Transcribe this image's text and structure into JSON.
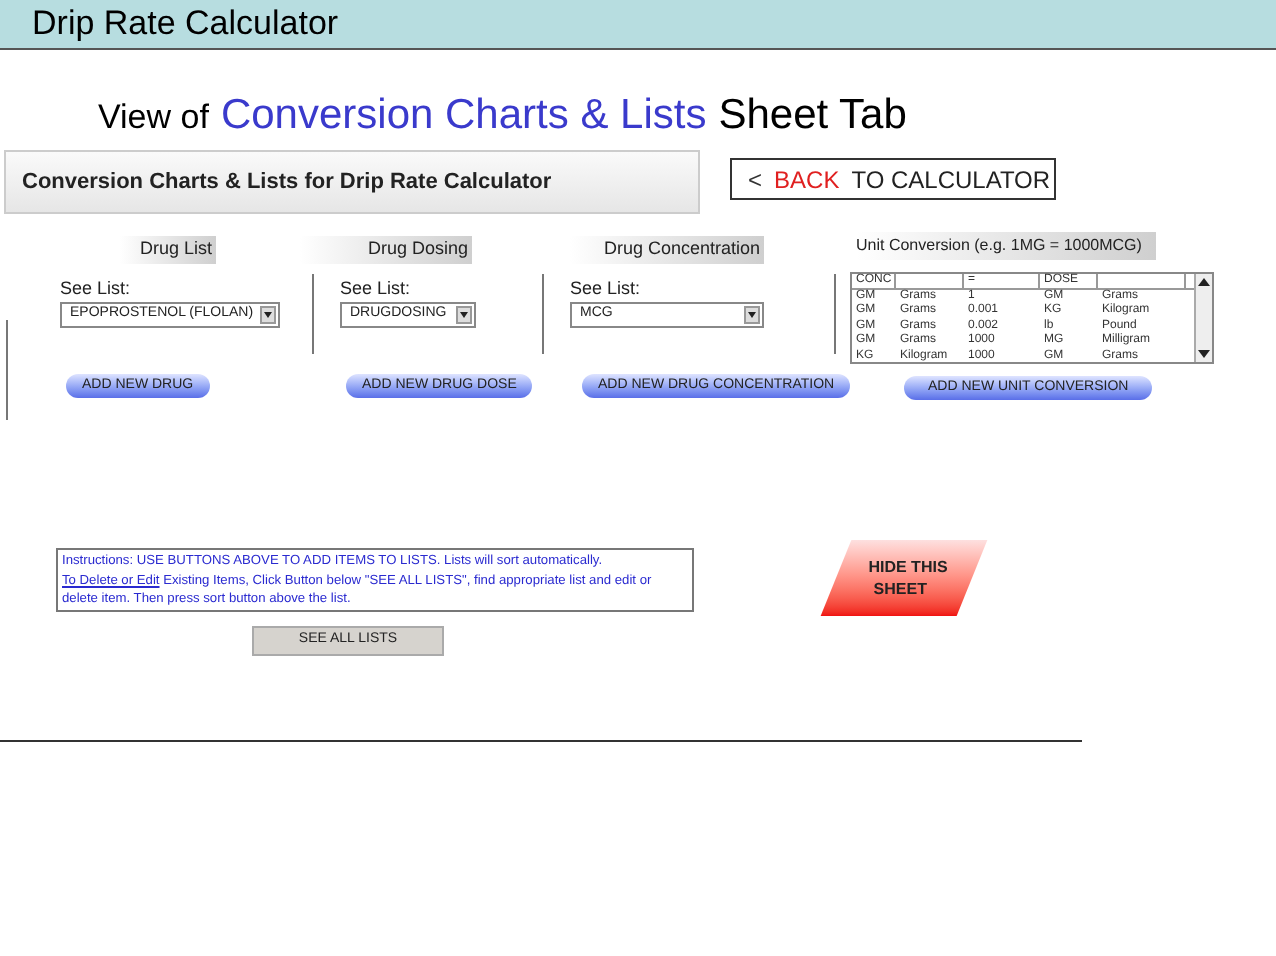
{
  "slide_header": {
    "title": "Drip Rate Calculator"
  },
  "subtitle": {
    "prefix": "View of",
    "highlight": "Conversion Charts & Lists",
    "suffix": "Sheet Tab"
  },
  "sheet_title": "Conversion Charts & Lists for Drip Rate Calculator",
  "back_button": {
    "icon": "<",
    "accent": "BACK",
    "label": "TO CALCULATOR"
  },
  "sections": [
    {
      "heading": "Drug List",
      "see_list_label": "See List:",
      "dropdown_value": "EPOPROSTENOL (FLOLAN)",
      "button": "ADD NEW DRUG"
    },
    {
      "heading": "Drug Dosing",
      "see_list_label": "See List:",
      "dropdown_value": "DRUGDOSING",
      "button": "ADD NEW DRUG DOSE"
    },
    {
      "heading": "Drug Concentration",
      "see_list_label": "See List:",
      "dropdown_value": "MCG",
      "button": "ADD NEW DRUG CONCENTRATION"
    }
  ],
  "unit_conversion": {
    "heading": "Unit Conversion (e.g. 1MG = 1000MCG)",
    "columns": [
      "CONC",
      "",
      "=",
      "DOSE",
      ""
    ],
    "rows": [
      [
        "GM",
        "Grams",
        "1",
        "GM",
        "Grams"
      ],
      [
        "GM",
        "Grams",
        "0.001",
        "KG",
        "Kilogram"
      ],
      [
        "GM",
        "Grams",
        "0.002",
        "lb",
        "Pound"
      ],
      [
        "GM",
        "Grams",
        "1000",
        "MG",
        "Milligram"
      ],
      [
        "KG",
        "Kilogram",
        "1000",
        "GM",
        "Grams"
      ]
    ],
    "button": "ADD NEW UNIT CONVERSION"
  },
  "instructions": {
    "text_before": "Instructions: USE BUTTONS ABOVE TO ADD ITEMS TO LISTS. Lists will sort automatically.",
    "link": "To Delete or Edit",
    "text_after": "Existing Items, Click Button below \"SEE ALL LISTS\", find appropriate list and edit or delete item.  Then press sort button above the list."
  },
  "see_all_button": "SEE ALL LISTS",
  "hide_button": {
    "line_1": "HIDE THIS",
    "line_2": "SHEET"
  }
}
